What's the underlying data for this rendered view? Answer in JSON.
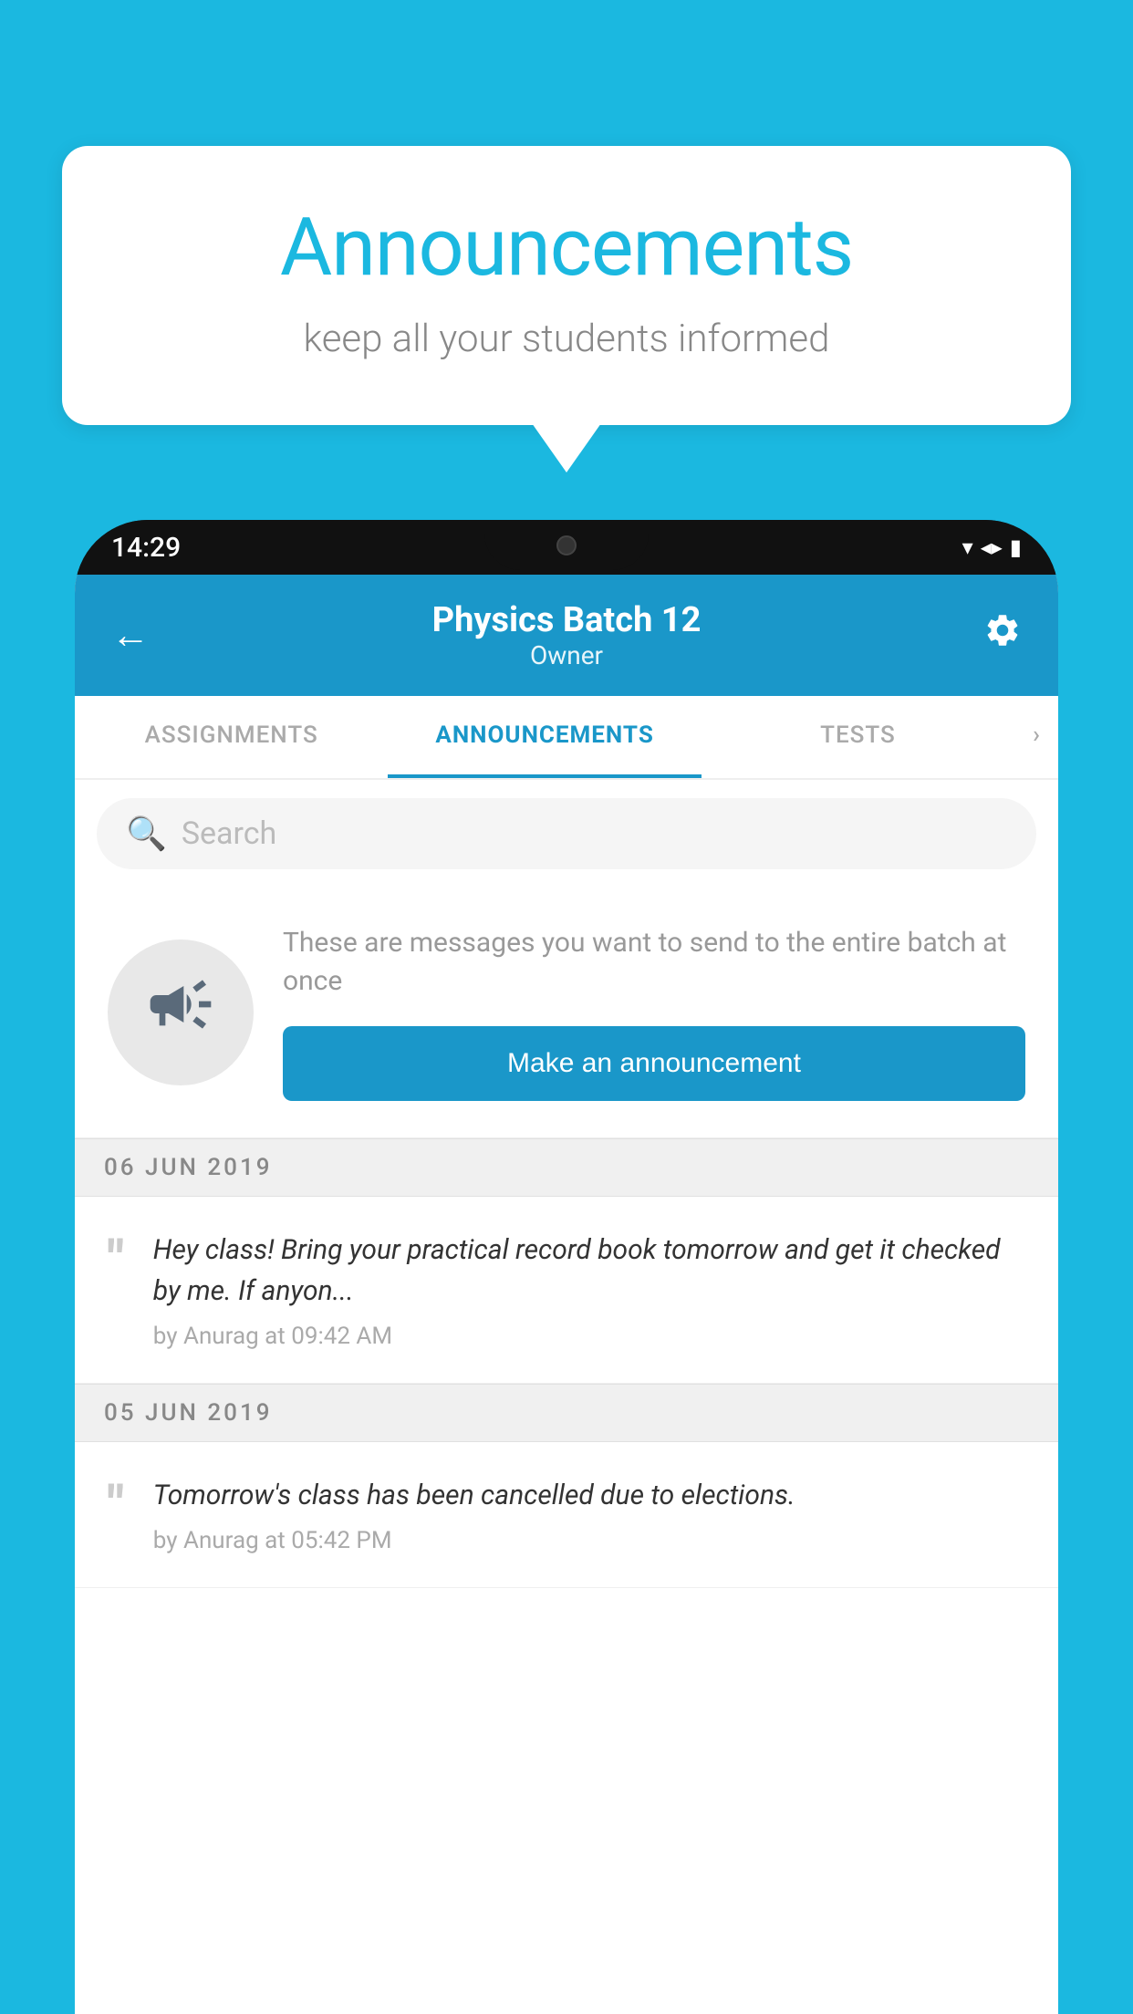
{
  "page": {
    "background_color": "#1bb8e0"
  },
  "speech_bubble": {
    "title": "Announcements",
    "subtitle": "keep all your students informed"
  },
  "phone": {
    "status_bar": {
      "time": "14:29",
      "wifi": "▾",
      "signal": "▴",
      "battery": "▮"
    },
    "header": {
      "back_label": "←",
      "batch_name": "Physics Batch 12",
      "owner_label": "Owner",
      "settings_label": "⚙"
    },
    "tabs": [
      {
        "label": "ASSIGNMENTS",
        "active": false
      },
      {
        "label": "ANNOUNCEMENTS",
        "active": true
      },
      {
        "label": "TESTS",
        "active": false
      }
    ],
    "search": {
      "placeholder": "Search"
    },
    "promo": {
      "description": "These are messages you want to send to the entire batch at once",
      "button_label": "Make an announcement"
    },
    "announcements": [
      {
        "date": "06  JUN  2019",
        "items": [
          {
            "text": "Hey class! Bring your practical record book tomorrow and get it checked by me. If anyon...",
            "meta": "by Anurag at 09:42 AM"
          }
        ]
      },
      {
        "date": "05  JUN  2019",
        "items": [
          {
            "text": "Tomorrow's class has been cancelled due to elections.",
            "meta": "by Anurag at 05:42 PM"
          }
        ]
      }
    ]
  }
}
